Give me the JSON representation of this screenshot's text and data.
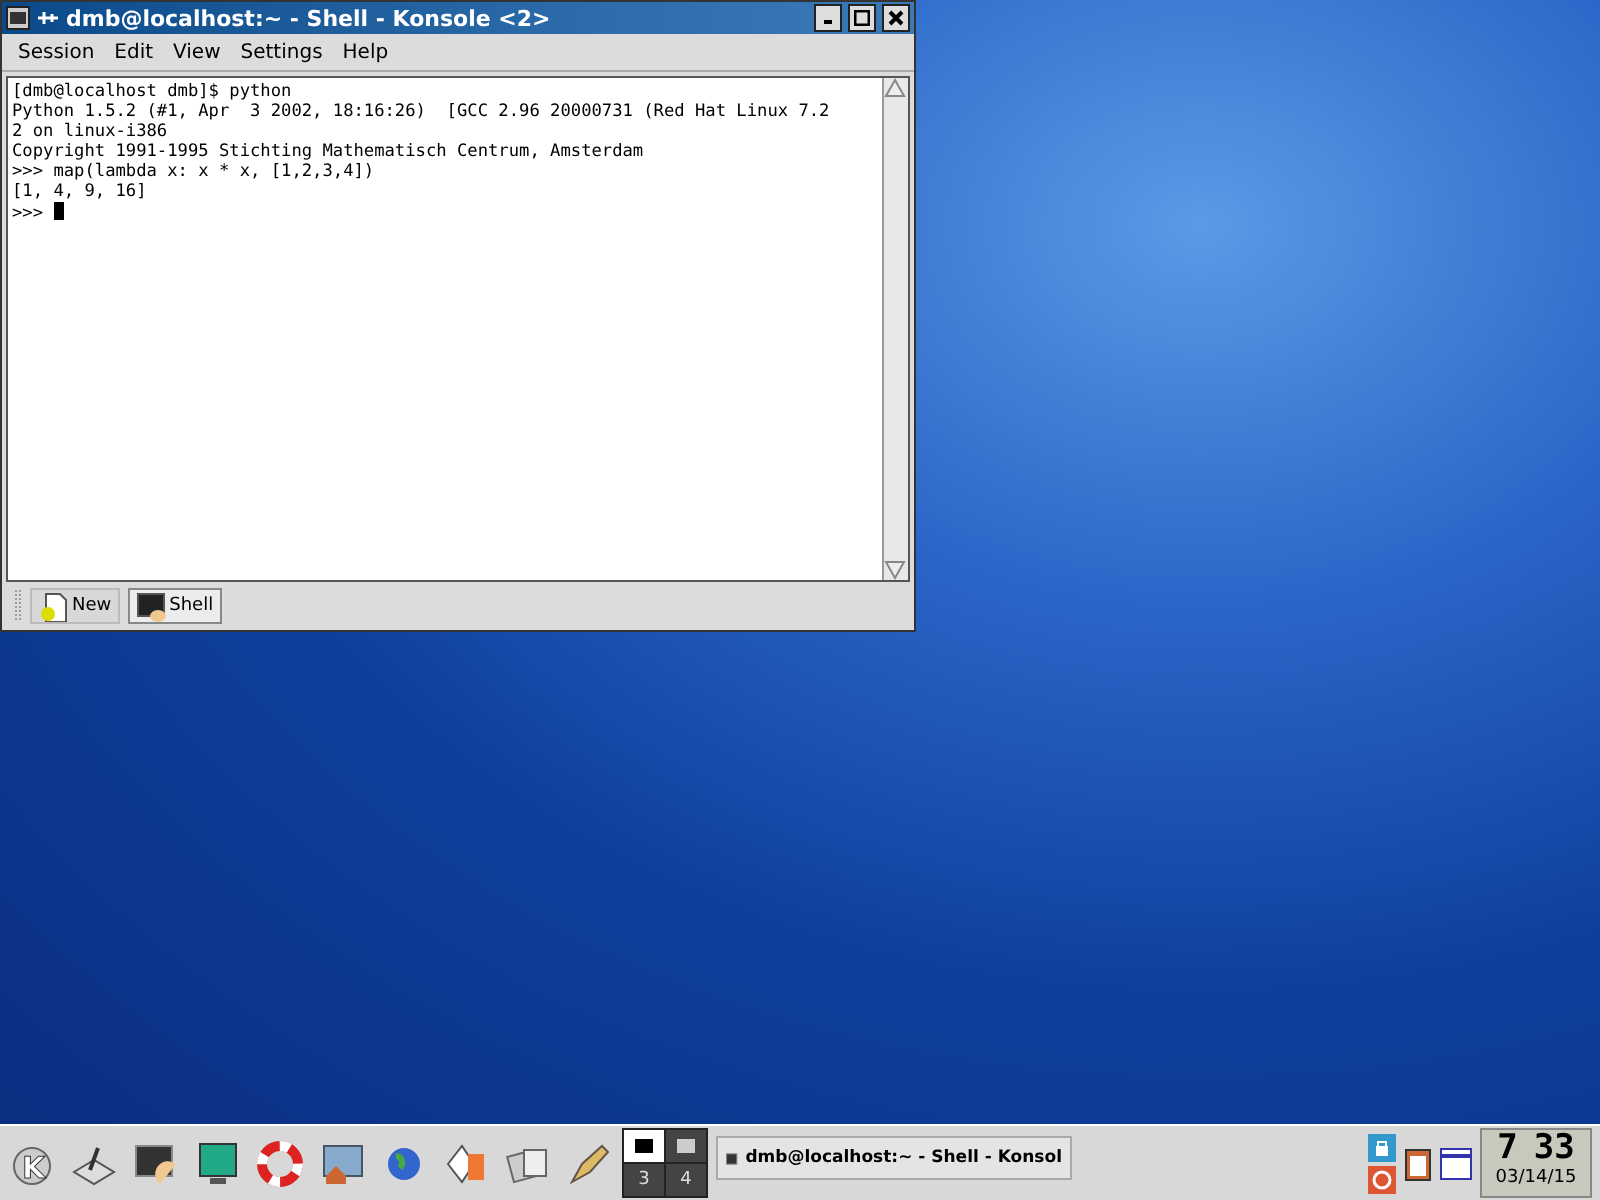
{
  "window": {
    "title": "dmb@localhost:~ - Shell - Konsole <2>",
    "menu": [
      "Session",
      "Edit",
      "View",
      "Settings",
      "Help"
    ],
    "terminal": {
      "lines": [
        "[dmb@localhost dmb]$ python",
        "Python 1.5.2 (#1, Apr  3 2002, 18:16:26)  [GCC 2.96 20000731 (Red Hat Linux 7.2",
        "2 on linux-i386",
        "Copyright 1991-1995 Stichting Mathematisch Centrum, Amsterdam",
        ">>> map(lambda x: x * x, [1,2,3,4])",
        "[1, 4, 9, 16]",
        ">>> "
      ],
      "cursor": true
    },
    "tabs": [
      {
        "label": "New",
        "kind": "new",
        "selected": false
      },
      {
        "label": "Shell",
        "kind": "session",
        "selected": true
      }
    ]
  },
  "taskbar": {
    "logo": "K",
    "desktops": [
      {
        "selected": true
      },
      {
        "selected": false
      },
      {
        "label": "3",
        "selected": false
      },
      {
        "label": "4",
        "selected": false
      }
    ],
    "task": "dmb@localhost:~ - Shell - Konsol",
    "clock": {
      "hour": "7",
      "minute": "33",
      "date": "03/14/15"
    }
  }
}
